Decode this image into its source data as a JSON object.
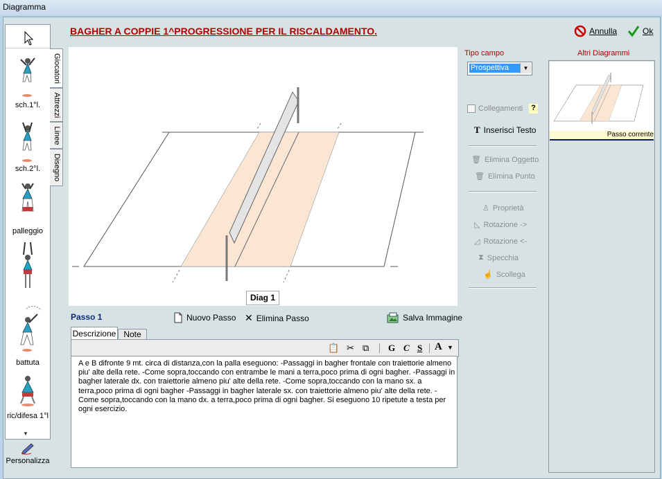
{
  "window": {
    "title": "Diagramma"
  },
  "header": {
    "diagram_title": "BAGHER A COPPIE 1^PROGRESSIONE PER IL RISCALDAMENTO.",
    "cancel_label": "Annulla",
    "ok_label": "Ok"
  },
  "toolbox": {
    "items": [
      {
        "label": "sch.1°l."
      },
      {
        "label": "sch.2°l."
      },
      {
        "label": "palleggio"
      },
      {
        "label": ""
      },
      {
        "label": "battuta"
      },
      {
        "label": "ric/difesa 1°l"
      }
    ],
    "customize_label": "Personalizza"
  },
  "side_tabs": [
    "Giocatori",
    "Attrezzi",
    "Linee",
    "Disegno"
  ],
  "canvas": {
    "diagram_tab": "Diag 1"
  },
  "step": {
    "label": "Passo 1",
    "new_step": "Nuovo Passo",
    "delete_step": "Elimina Passo",
    "save_image": "Salva Immagine"
  },
  "editor": {
    "tabs": [
      "Descrizione",
      "Note"
    ],
    "toolbar": {
      "bold": "G",
      "italic": "C",
      "underline": "S",
      "font": "A"
    },
    "text": "A e B difronte  9 mt. circa di distanza,con la palla eseguono: -Passaggi in bagher frontale con traiettorie almeno piu' alte della rete. -Come sopra,toccando con entrambe le mani a terra,poco prima di ogni bagher. -Passaggi in bagher laterale dx. con traiettorie almeno piu' alte della rete. -Come sopra,toccando con la mano sx. a terra,poco prima di ogni bagher -Passaggi in bagher laterale sx. con traiettorie almeno piu' alte della rete. -Come sopra,toccando con la mano dx. a terra,poco prima di ogni bagher. Si eseguono 10 ripetute a testa per ogni esercizio."
  },
  "right_panel": {
    "field_type_label": "Tipo campo",
    "field_type_value": "Prospettiva",
    "connections_label": "Collegamenti",
    "help_label": "?",
    "insert_text": "Inserisci Testo",
    "delete_object": "Elimina Oggetto",
    "delete_point": "Elimina Punto",
    "properties": "Proprietà",
    "rotate_right": "Rotazione ->",
    "rotate_left": "Rotazione <-",
    "mirror": "Specchia",
    "slide": "Scollega",
    "other_diagrams_label": "Altri Diagrammi",
    "current_step": "Passo corrente"
  },
  "colors": {
    "title_red": "#b00000",
    "accent_blue": "#0b2a7a",
    "court_fill": "#fbe6d4"
  }
}
